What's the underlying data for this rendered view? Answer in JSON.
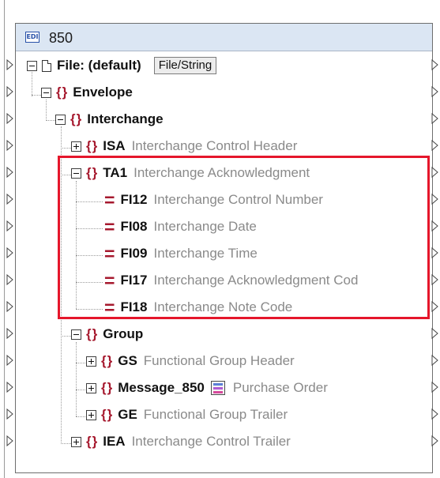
{
  "component": {
    "icon": "EDI",
    "title": "850",
    "file_label": "File: (default)",
    "file_button": "File/String"
  },
  "tree": [
    {
      "name": "Envelope",
      "desc": ""
    },
    {
      "name": "Interchange",
      "desc": ""
    },
    {
      "name": "ISA",
      "desc": "Interchange Control Header"
    },
    {
      "name": "TA1",
      "desc": "Interchange Acknowledgment"
    },
    {
      "name": "FI12",
      "desc": "Interchange Control Number"
    },
    {
      "name": "FI08",
      "desc": "Interchange Date"
    },
    {
      "name": "FI09",
      "desc": "Interchange Time"
    },
    {
      "name": "FI17",
      "desc": "Interchange Acknowledgment Cod"
    },
    {
      "name": "FI18",
      "desc": "Interchange Note Code"
    },
    {
      "name": "Group",
      "desc": ""
    },
    {
      "name": "GS",
      "desc": "Functional Group Header"
    },
    {
      "name": "Message_850",
      "desc": "Purchase Order"
    },
    {
      "name": "GE",
      "desc": "Functional Group Trailer"
    },
    {
      "name": "IEA",
      "desc": "Interchange Control Trailer"
    }
  ],
  "highlight_color": "#e5162b",
  "element_color": "#a6192e"
}
